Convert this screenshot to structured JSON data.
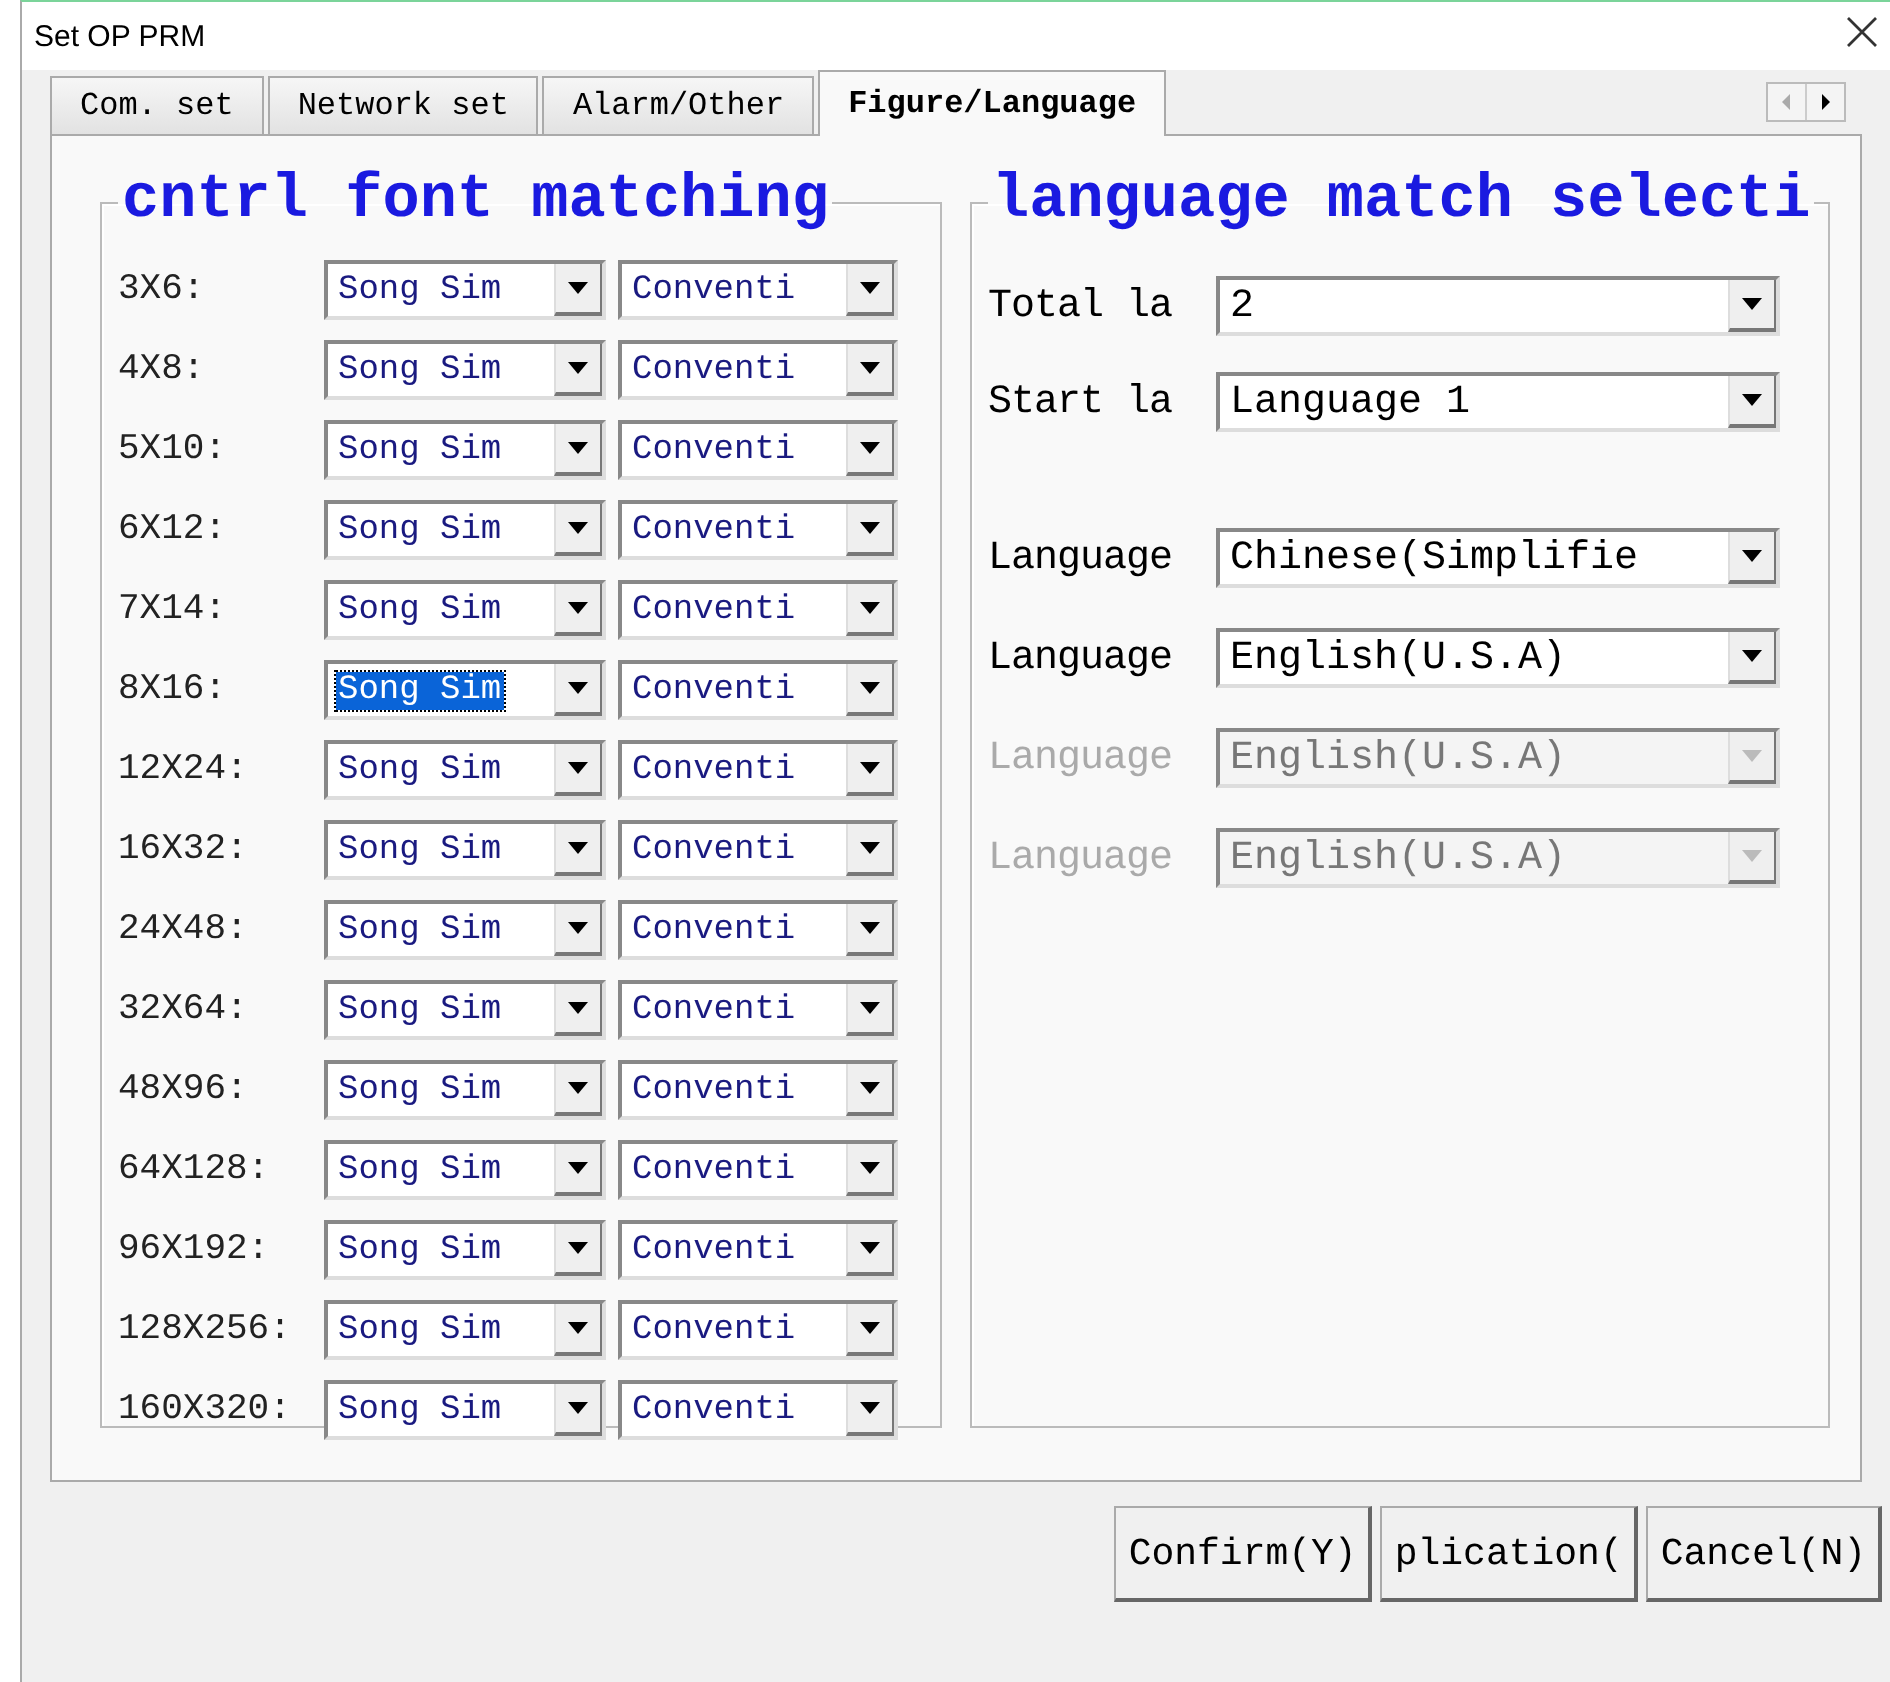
{
  "window": {
    "title": "Set OP PRM"
  },
  "tabs": [
    {
      "label": "Com. set",
      "selected": false
    },
    {
      "label": "Network set",
      "selected": false
    },
    {
      "label": "Alarm/Other",
      "selected": false
    },
    {
      "label": "Figure/Language",
      "selected": true
    }
  ],
  "font_group": {
    "title": "cntrl font matching",
    "rows": [
      {
        "label": "3X6:",
        "font": "Song Sim",
        "selected": false,
        "style": "Conventi"
      },
      {
        "label": "4X8:",
        "font": "Song Sim",
        "selected": false,
        "style": "Conventi"
      },
      {
        "label": "5X10:",
        "font": "Song Sim",
        "selected": false,
        "style": "Conventi"
      },
      {
        "label": "6X12:",
        "font": "Song Sim",
        "selected": false,
        "style": "Conventi"
      },
      {
        "label": "7X14:",
        "font": "Song Sim",
        "selected": false,
        "style": "Conventi"
      },
      {
        "label": "8X16:",
        "font": "Song Sim",
        "selected": true,
        "style": "Conventi"
      },
      {
        "label": "12X24:",
        "font": "Song Sim",
        "selected": false,
        "style": "Conventi"
      },
      {
        "label": "16X32:",
        "font": "Song Sim",
        "selected": false,
        "style": "Conventi"
      },
      {
        "label": "24X48:",
        "font": "Song Sim",
        "selected": false,
        "style": "Conventi"
      },
      {
        "label": "32X64:",
        "font": "Song Sim",
        "selected": false,
        "style": "Conventi"
      },
      {
        "label": "48X96:",
        "font": "Song Sim",
        "selected": false,
        "style": "Conventi"
      },
      {
        "label": "64X128:",
        "font": "Song Sim",
        "selected": false,
        "style": "Conventi"
      },
      {
        "label": "96X192:",
        "font": "Song Sim",
        "selected": false,
        "style": "Conventi"
      },
      {
        "label": "128X256:",
        "font": "Song Sim",
        "selected": false,
        "style": "Conventi"
      },
      {
        "label": "160X320:",
        "font": "Song Sim",
        "selected": false,
        "style": "Conventi"
      }
    ]
  },
  "language_group": {
    "title": "language match selecti",
    "settings": [
      {
        "label": "Total la",
        "value": "2"
      },
      {
        "label": "Start la",
        "value": "Language 1"
      }
    ],
    "languages": [
      {
        "label": "Language",
        "value": "Chinese(Simplifie",
        "disabled": false
      },
      {
        "label": "Language",
        "value": "English(U.S.A)",
        "disabled": false
      },
      {
        "label": "Language",
        "value": "English(U.S.A)",
        "disabled": true
      },
      {
        "label": "Language",
        "value": "English(U.S.A)",
        "disabled": true
      }
    ]
  },
  "buttons": [
    {
      "label": "Confirm(Y)"
    },
    {
      "label": "plication("
    },
    {
      "label": "Cancel(N)"
    }
  ]
}
